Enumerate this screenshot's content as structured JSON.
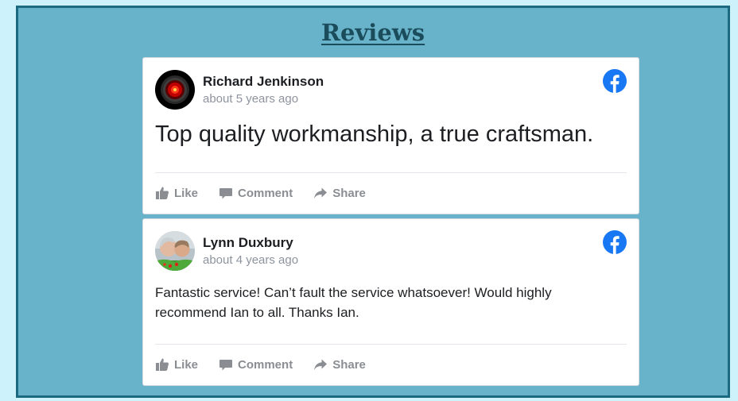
{
  "section": {
    "title": "Reviews"
  },
  "reviews": [
    {
      "author": "Richard Jenkinson",
      "time": "about 5 years ago",
      "text": "Top quality workmanship, a true craftsman."
    },
    {
      "author": "Lynn Duxbury",
      "time": "about 4 years ago",
      "text": "Fantastic service! Can’t fault the service whatsoever! Would highly recommend Ian to all. Thanks Ian."
    }
  ],
  "actions": {
    "like": "Like",
    "comment": "Comment",
    "share": "Share"
  },
  "colors": {
    "page_background": "#cdf2fb",
    "panel_background": "#69b3ca",
    "panel_border": "#1b6a82",
    "title": "#1b4c5c",
    "facebook_blue": "#1877f2",
    "action_grey": "#8a8d91"
  },
  "icons": [
    "hal-eye-avatar",
    "family-photo-avatar",
    "facebook-icon",
    "thumbs-up-icon",
    "comment-icon",
    "share-arrow-icon"
  ]
}
